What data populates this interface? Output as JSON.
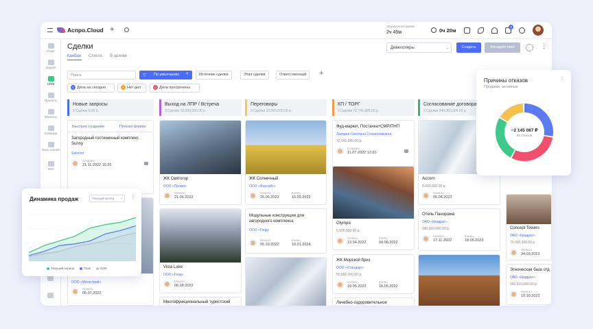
{
  "app": {
    "logo": "Аспро.Cloud",
    "time_label": "Затраченное время",
    "time_value": "2ч 45м",
    "timer": "0ч 20м",
    "notif_count": "3"
  },
  "sidebar": [
    "Старт",
    "Задачи",
    "CRM",
    "Проекты",
    "Финансы",
    "Команда",
    "База знаний",
    "Тайт"
  ],
  "page": {
    "title": "Сделки",
    "tabs": [
      "Канбан",
      "Список",
      "В архиве"
    ],
    "select_value": "Девелоперы",
    "create_label": "Создать",
    "auto_label": "Автодействия"
  },
  "filters": {
    "search_placeholder": "Поиск",
    "default_label": "По умолчанию",
    "chips": [
      "Источник сделки",
      "Этап сделки",
      "Ответственный"
    ],
    "badges": [
      {
        "count": "0",
        "label": "Дела на сегодня",
        "color": "#4a6cf7"
      },
      {
        "count": "0",
        "label": "Нет дел",
        "color": "#f5a524"
      },
      {
        "count": "0",
        "label": "Дела просрочены",
        "color": "#e8505b"
      }
    ]
  },
  "columns": [
    {
      "title": "Новые запросы",
      "sub": "3 Сделки    0,00 р.",
      "color": "#4a6cf7"
    },
    {
      "title": "Выход на ЛПР / Встреча",
      "sub": "3 Сделки    10,000,000.00 р.",
      "color": "#b45fe0"
    },
    {
      "title": "Переговоры",
      "sub": "3 Сделки    10,000,000.00 р.",
      "color": "#f2c94c"
    },
    {
      "title": "КП / ТОРГ",
      "sub": "3 Сделки    72,741,985.00 р.",
      "color": "#f2994a"
    },
    {
      "title": "Согласование договора",
      "sub": "3 Сделки    249,000,000.00 р.",
      "color": "#3cb371"
    }
  ],
  "col1": {
    "quick_create": "Быстрое создание",
    "full_form": "Полная форма",
    "card_title": "Загородный гостиничный комплекс Sunny",
    "card_link": "Selector",
    "created_lbl": "Создана",
    "created_val": "21.11.2022 15:26",
    "bottom_link": "ООО «Мегастрой»",
    "bottom_lbl": "Начало",
    "bottom_val": "05.07.2022"
  },
  "col2": {
    "c1_title": "ЖК Святогор",
    "c1_link": "ООО «Промо»",
    "c1_start_lbl": "Начало",
    "c1_start": "21.06.2022",
    "c2_title": "Vista Lake",
    "c2_link": "ООО «Гелд»",
    "c2_start_lbl": "Начало",
    "c2_start": "06.08.2022",
    "c3_title": "Многофункциональный туристский"
  },
  "col3": {
    "c1_title": "ЖК Солнечный",
    "c1_link": "ООО «Форсайт»",
    "start_lbl": "Начало",
    "end_lbl": "Конец",
    "c1_start": "25.05.2022",
    "c1_end": "15.09.2022",
    "c2_title": "Модульные конструкции для загородного комплекса",
    "c2_link": "ООО «Гелд»",
    "c2_start": "05.10.2022",
    "c2_end": "10.01.2024"
  },
  "col4": {
    "c1_title": "Фуд-маркет, Постачка+СМР/ПНП",
    "c1_link": "Лазорев Светлана Станиславовна",
    "c1_sum": "72,741,985.00 р.",
    "c1_lbl": "Создана",
    "c1_val": "11.07.2022 12:20",
    "c2_title": "Olympic",
    "c2_sum": "5,000,000.00 р.",
    "start_lbl": "Начало",
    "end_lbl": "Конец",
    "c2_start": "13.04.2022",
    "c2_end": "04.08.2022",
    "c3_title": "ЖК Морской бриз",
    "c3_link": "ООО «Стандарт»",
    "c3_sum": "50,000,000.00 р.",
    "c3_start": "19.05.2022",
    "c3_end": "18.05.2022",
    "c4_title": "Лечебно-оздоровительное"
  },
  "col5": {
    "c1_title": "Accorn",
    "c1_sum": "8,000,000.00 р.",
    "c1_lbl": "Начало",
    "c1_val": "05.04.2022",
    "c2_title": "Отель Панорама",
    "c2_link": "ОАО «Квадрат»",
    "c2_sum": "240,000,000.00 р.",
    "start_lbl": "Начало",
    "end_lbl": "Конец",
    "c2_start": "17.11.2022",
    "c2_end": "18.05.2023"
  },
  "col6": {
    "c1_title": "Concept Towers",
    "c1_link": "ОАО «Квадрат»",
    "c1_sum": "70,000,000.00 р.",
    "c1_lbl": "Начало",
    "c1_val": "24.03.2022",
    "c2_title": "Этническая база отд",
    "c2_link": "ОАО «Квадрат»",
    "c2_sum": "150,910,000.00 р.",
    "c2_lbl": "Начало",
    "c2_val": "19.10.2022"
  },
  "sales_panel": {
    "title": "Динамика продаж",
    "select": "Текущий месяц",
    "legend": [
      {
        "label": "Текущий период",
        "color": "#3ec98a"
      },
      {
        "label": "План",
        "color": "#5b7cf0"
      },
      {
        "label": "2025",
        "color": "#b8bfcc"
      }
    ]
  },
  "refusal_panel": {
    "title": "Причины отказов",
    "subtitle": "Продажи, активные",
    "total": "−2 145 087 ₽",
    "count": "85 отказов"
  },
  "chart_data": [
    {
      "type": "area",
      "title": "Динамика продаж",
      "x": [
        1,
        2,
        3,
        4,
        5,
        6,
        7,
        8
      ],
      "series": [
        {
          "name": "Текущий период",
          "values": [
            10,
            22,
            30,
            38,
            52,
            58,
            62,
            70
          ]
        },
        {
          "name": "План",
          "values": [
            5,
            12,
            22,
            25,
            30,
            42,
            48,
            56
          ]
        },
        {
          "name": "2025",
          "values": [
            3,
            8,
            12,
            20,
            25,
            30,
            38,
            44
          ]
        }
      ]
    },
    {
      "type": "pie",
      "title": "Причины отказов",
      "values": [
        28,
        30,
        26,
        16
      ],
      "colors": [
        "#5b7cf0",
        "#f0506e",
        "#3ec98a",
        "#f5c04c"
      ]
    }
  ]
}
